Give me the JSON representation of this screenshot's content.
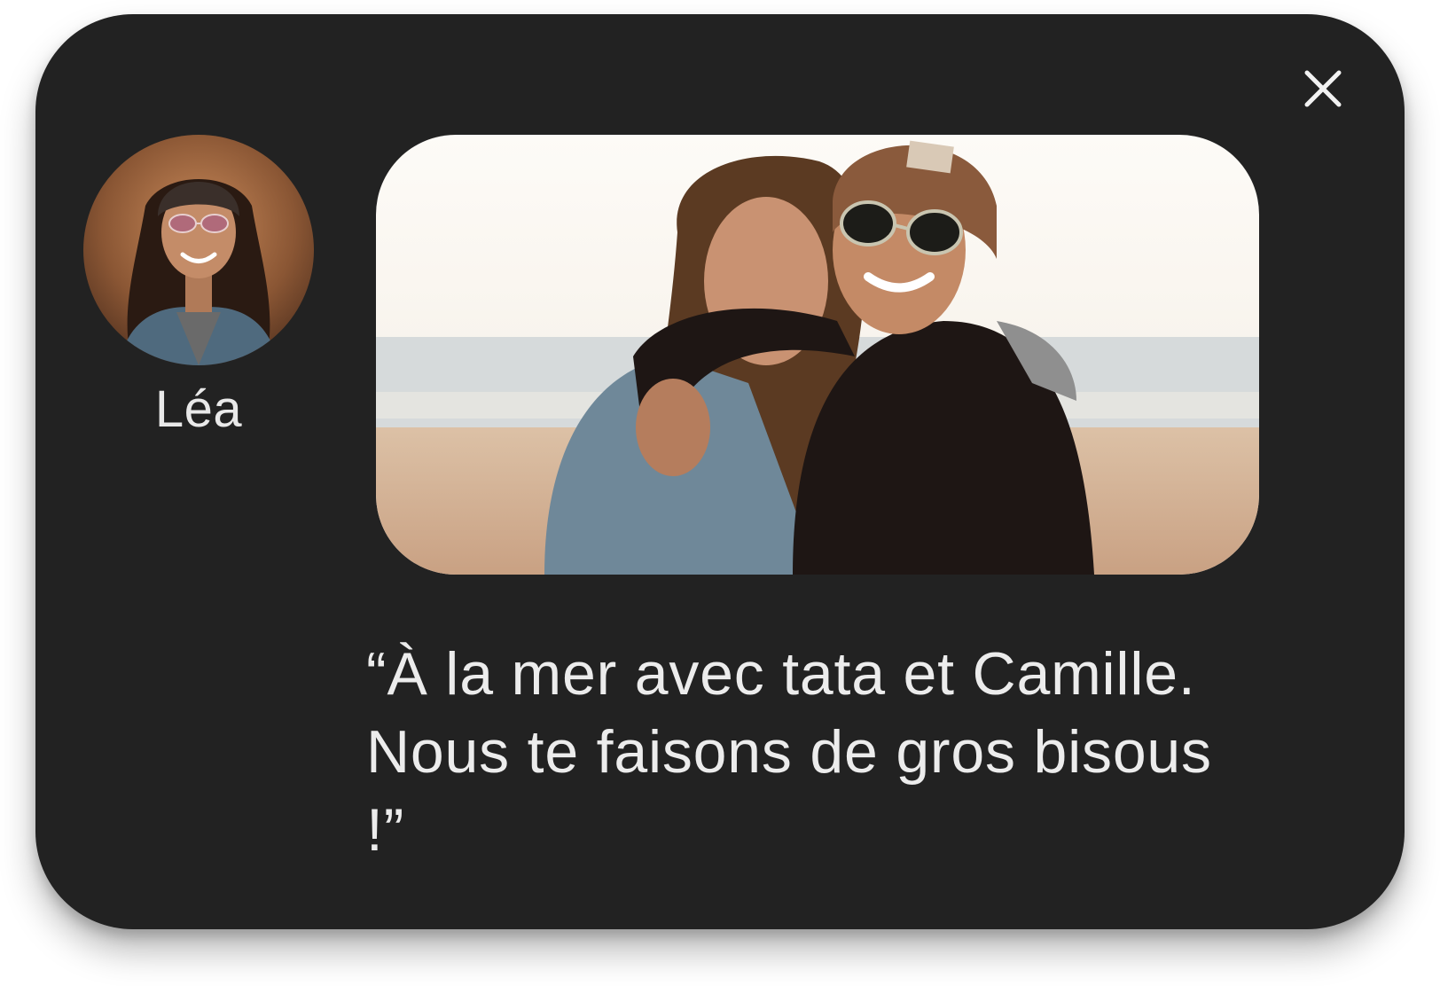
{
  "notification": {
    "close_icon": "close-icon",
    "sender": {
      "name": "Léa",
      "avatar": "avatar-photo"
    },
    "photo": "beach-photo",
    "message": "“À la mer avec tata et Camille. Nous te faisons de gros bisous !”"
  },
  "colors": {
    "card_background": "#222222",
    "text": "#ececec",
    "page_background": "#ffffff"
  }
}
